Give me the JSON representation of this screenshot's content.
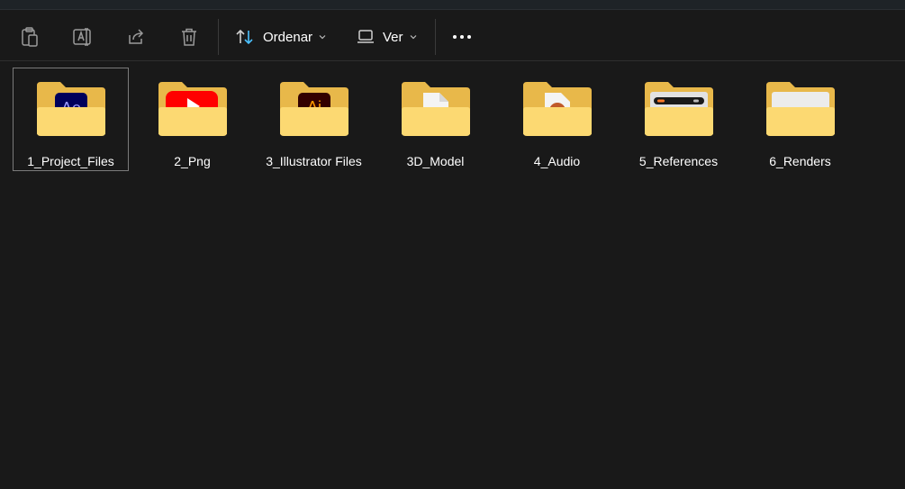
{
  "toolbar": {
    "paste_icon": "clipboard-icon",
    "rename_icon": "rename-icon",
    "share_icon": "share-icon",
    "delete_icon": "trash-icon",
    "sort_label": "Ordenar",
    "view_label": "Ver",
    "more_icon": "more-horizontal-icon"
  },
  "folders": [
    {
      "name": "1_Project_Files",
      "thumb": "after-effects-icon",
      "selected": true
    },
    {
      "name": "2_Png",
      "thumb": "youtube-icon"
    },
    {
      "name": "3_Illustrator Files",
      "thumb": "illustrator-icon"
    },
    {
      "name": "3D_Model",
      "thumb": "document-icon"
    },
    {
      "name": "4_Audio",
      "thumb": "audio-file-icon"
    },
    {
      "name": "5_References",
      "thumb": "reference-image-icon"
    },
    {
      "name": "6_Renders",
      "thumb": "render-image-icon"
    }
  ],
  "colors": {
    "background": "#191919",
    "folder_back": "#e8b84a",
    "folder_front": "#fcd972",
    "ae_bg": "#00005b",
    "ae_text": "#9999ff",
    "ai_bg": "#330000",
    "ai_text": "#ff9a00",
    "yt_red": "#ff0000",
    "accent_blue": "#4cc2ff"
  }
}
